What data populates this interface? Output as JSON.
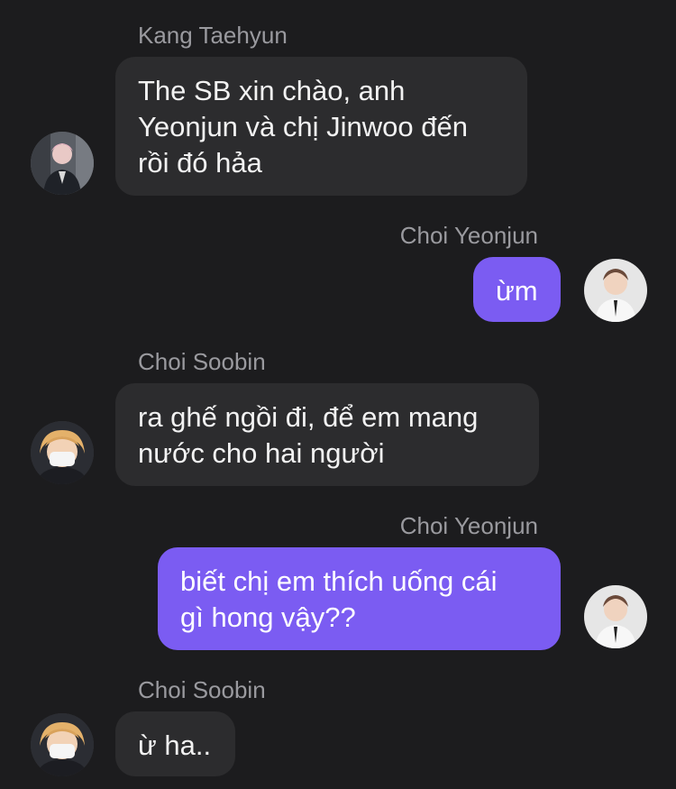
{
  "messages": [
    {
      "sender": "Kang Taehyun",
      "side": "left",
      "text": "The SB xin chào, anh\nYeonjun và chị Jinwoo đến\nrồi đó hảa",
      "avatar": "avatar-taehyun"
    },
    {
      "sender": "Choi Yeonjun",
      "side": "right",
      "text": "ừm",
      "avatar": "avatar-yeonjun"
    },
    {
      "sender": "Choi Soobin",
      "side": "left",
      "text": "ra ghế ngồi đi, để em mang\nnước cho hai người",
      "avatar": "avatar-soobin"
    },
    {
      "sender": "Choi Yeonjun",
      "side": "right",
      "text": "biết chị em thích uống cái\ngì hong vậy??",
      "avatar": "avatar-yeonjun"
    },
    {
      "sender": "Choi Soobin",
      "side": "left",
      "text": "ừ ha..",
      "avatar": "avatar-soobin"
    }
  ],
  "colors": {
    "background": "#1c1c1e",
    "incoming_bubble": "#2c2c2e",
    "outgoing_bubble": "#7b5cf2",
    "sender_name": "#9a9a9f"
  }
}
